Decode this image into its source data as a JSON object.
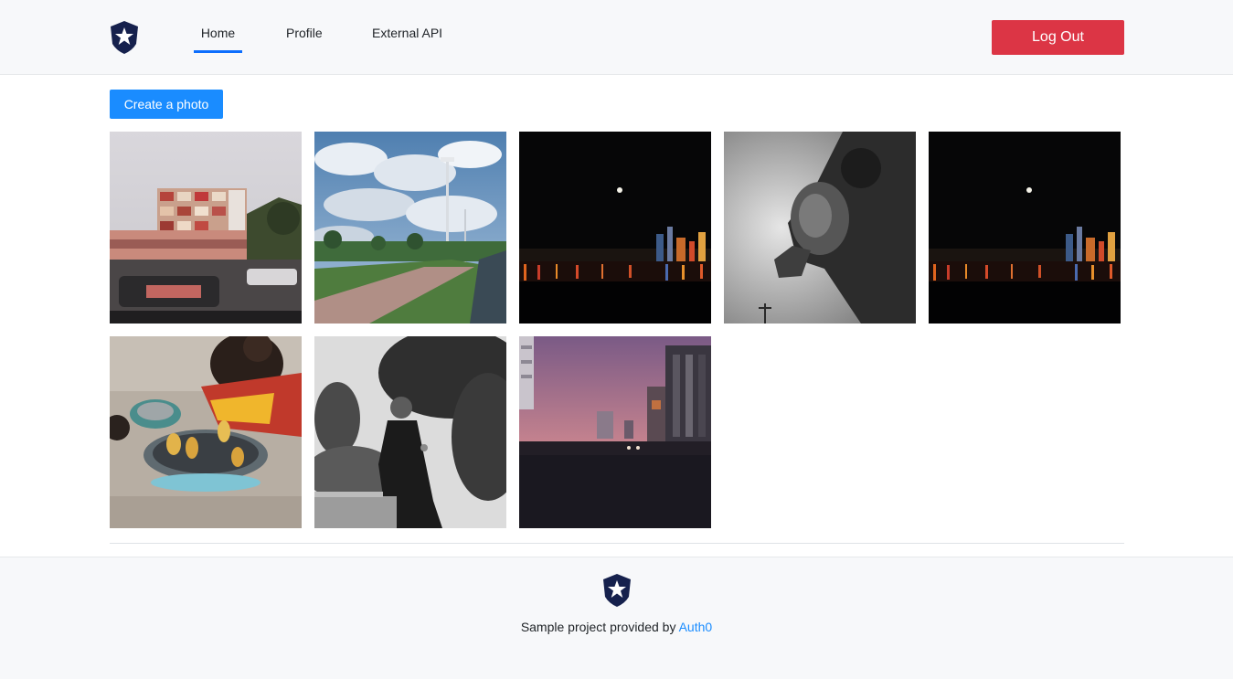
{
  "nav": {
    "logo_icon": "auth0-star-shield-icon",
    "links": [
      {
        "label": "Home",
        "active": true
      },
      {
        "label": "Profile",
        "active": false
      },
      {
        "label": "External API",
        "active": false
      }
    ],
    "logout_label": "Log Out"
  },
  "main": {
    "create_label": "Create a photo",
    "photos": [
      {
        "subject": "street-buildings"
      },
      {
        "subject": "cloudy-promenade"
      },
      {
        "subject": "night-skyline"
      },
      {
        "subject": "bw-astronaut"
      },
      {
        "subject": "night-skyline"
      },
      {
        "subject": "grill-vendor"
      },
      {
        "subject": "bw-portrait-tree"
      },
      {
        "subject": "dusk-street"
      }
    ]
  },
  "footer": {
    "logo_icon": "auth0-star-shield-icon",
    "text": "Sample project provided by",
    "link_label": "Auth0"
  },
  "colors": {
    "accent_blue": "#1a8cff",
    "nav_active": "#0d6efd",
    "danger": "#dc3545",
    "nav_bg": "#f7f8fa"
  }
}
